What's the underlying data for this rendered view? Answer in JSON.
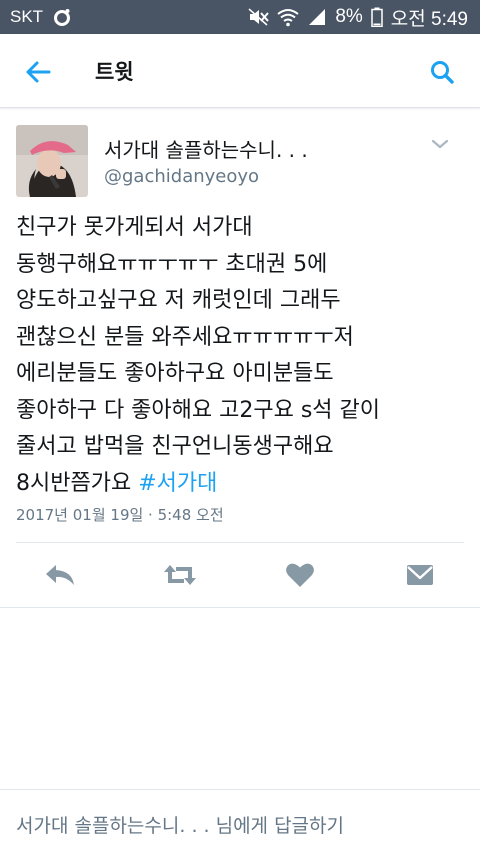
{
  "status_bar": {
    "carrier": "SKT",
    "battery": "8%",
    "time": "오전 5:49"
  },
  "app_bar": {
    "title": "트윗",
    "back_icon": "arrow-left-icon",
    "search_icon": "search-icon"
  },
  "tweet": {
    "display_name": "서가대 솔플하는수니. . .",
    "username": "@gachidanyeoyo",
    "text": "친구가 못가게되서 서가대\n동행구해요ㅠㅠㅜㅠㅜ 초대권 5에\n양도하고싶구요 저 캐럿인데 그래두\n괜찮으신 분들 와주세요ㅠㅠㅠㅠㅜ저\n에리분들도 좋아하구요 아미분들도\n좋아하구 다 좋아해요 고2구요 s석 같이\n줄서고 밥먹을 친구언니동생구해요\n8시반쯤가요 ",
    "hashtag": "#서가대",
    "timestamp": "2017년 01월 19일 · 5:48 오전"
  },
  "actions": {
    "reply_icon": "reply-icon",
    "retweet_icon": "retweet-icon",
    "like_icon": "heart-icon",
    "dm_icon": "envelope-icon"
  },
  "reply_box": {
    "placeholder": "서가대 솔플하는수니. . .  님에게 답글하기"
  },
  "colors": {
    "status_bar_bg": "#495464",
    "accent": "#1da1f2",
    "icon_gray": "#8899a6",
    "secondary_text": "#657786"
  }
}
